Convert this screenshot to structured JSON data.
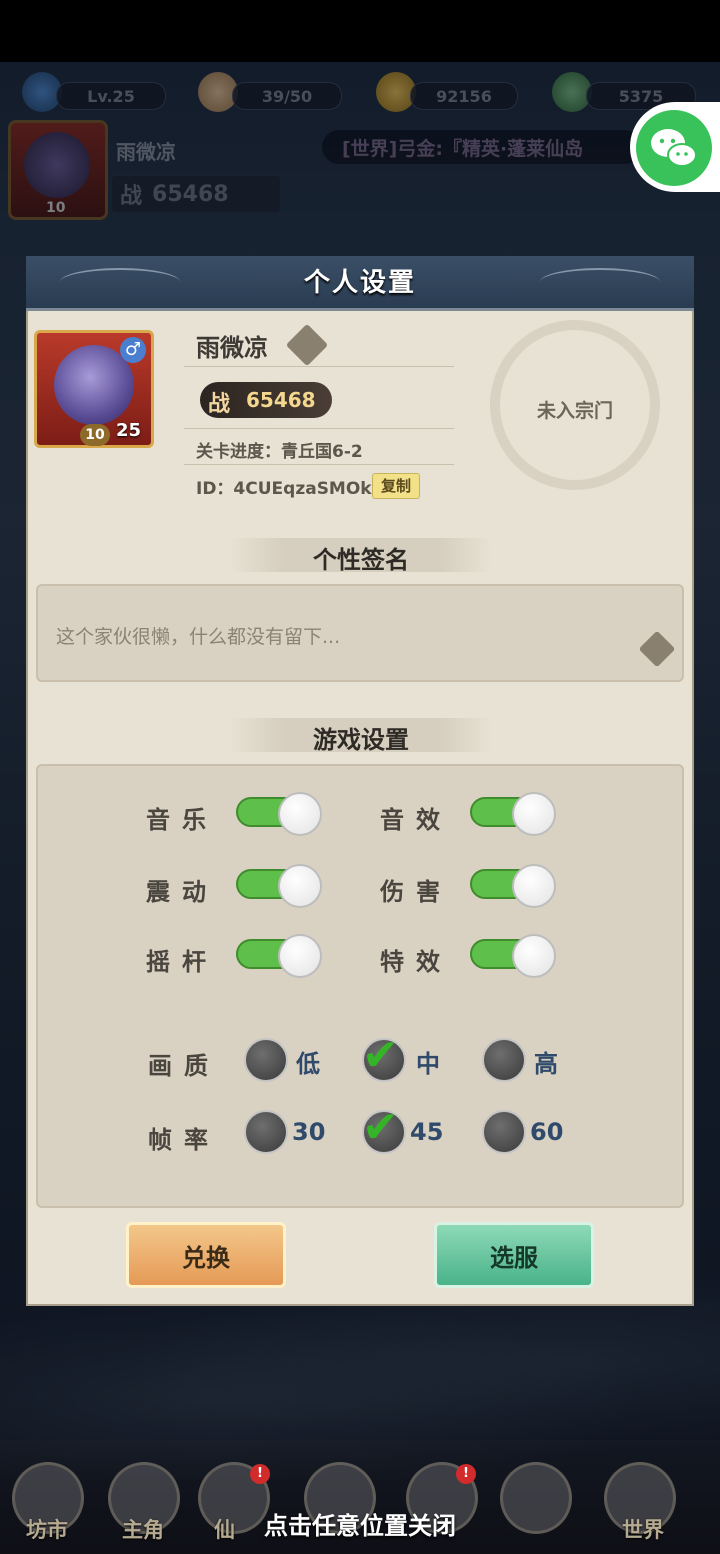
{
  "hud": {
    "level": "Lv.25",
    "stamina": "39/50",
    "coins": "92156",
    "jade": "5375",
    "player_name": "雨微凉",
    "power_label": "战",
    "power": "65468",
    "world_marquee": "[世界]弓金:『精英·蓬莱仙岛",
    "avatar_level": "10"
  },
  "panel": {
    "title": "个人设置",
    "profile": {
      "name": "雨微凉",
      "power_label": "战",
      "power": "65468",
      "avatar_star": "10",
      "avatar_level": "25",
      "progress": "关卡进度：青丘国6-2",
      "id": "ID：4CUEqzaSMOk",
      "copy_label": "复制",
      "sect_status": "未入宗门"
    },
    "signature": {
      "section_title": "个性签名",
      "text": "这个家伙很懒，什么都没有留下..."
    },
    "settings": {
      "section_title": "游戏设置",
      "toggles": [
        {
          "label": "音乐",
          "on": true
        },
        {
          "label": "音效",
          "on": true
        },
        {
          "label": "震动",
          "on": true
        },
        {
          "label": "伤害",
          "on": true
        },
        {
          "label": "摇杆",
          "on": true
        },
        {
          "label": "特效",
          "on": true
        }
      ],
      "quality": {
        "label": "画质",
        "options": [
          "低",
          "中",
          "高"
        ],
        "selected": "中"
      },
      "framerate": {
        "label": "帧率",
        "options": [
          "30",
          "45",
          "60"
        ],
        "selected": "45"
      }
    },
    "buttons": {
      "redeem": "兑换",
      "server": "选服"
    }
  },
  "bottom_nav": {
    "items": [
      "坊市",
      "主角",
      "仙",
      "",
      "",
      "",
      "世界"
    ],
    "close_hint": "点击任意位置关闭",
    "badge": "!"
  }
}
